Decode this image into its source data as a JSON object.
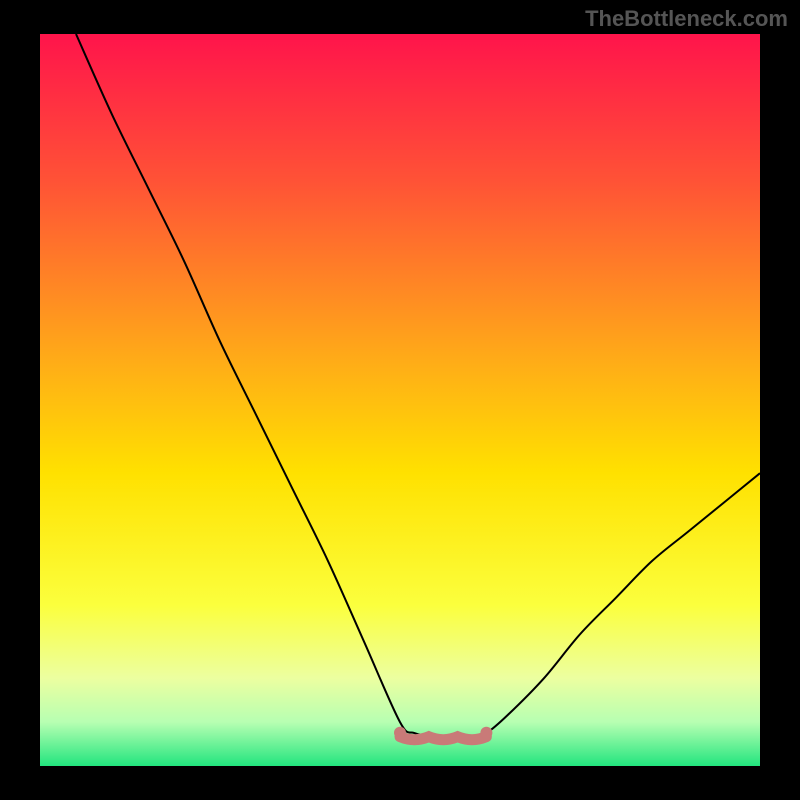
{
  "watermark": "TheBottleneck.com",
  "chart_data": {
    "type": "line",
    "title": "",
    "xlabel": "",
    "ylabel": "",
    "xlim": [
      0,
      1
    ],
    "ylim": [
      0,
      1
    ],
    "background_gradient": {
      "type": "vertical",
      "stops": [
        {
          "pos": 0.0,
          "color": "#ff144b"
        },
        {
          "pos": 0.2,
          "color": "#ff5236"
        },
        {
          "pos": 0.45,
          "color": "#ffad17"
        },
        {
          "pos": 0.6,
          "color": "#ffe100"
        },
        {
          "pos": 0.78,
          "color": "#fbff3d"
        },
        {
          "pos": 0.88,
          "color": "#ecffa0"
        },
        {
          "pos": 0.94,
          "color": "#b7ffb2"
        },
        {
          "pos": 1.0,
          "color": "#22e57e"
        }
      ]
    },
    "curve": {
      "note": "V-shaped curve; y=1 at top, y=0 at bottom. Flat valley ~x 0.50–0.62 at y≈0.04, left arm rises to top-left corner, right arm rises to ~y 0.40 at x=1.",
      "x": [
        0.05,
        0.1,
        0.15,
        0.2,
        0.25,
        0.3,
        0.35,
        0.4,
        0.45,
        0.5,
        0.52,
        0.55,
        0.58,
        0.6,
        0.62,
        0.65,
        0.7,
        0.75,
        0.8,
        0.85,
        0.9,
        0.95,
        1.0
      ],
      "y": [
        1.0,
        0.89,
        0.79,
        0.69,
        0.58,
        0.48,
        0.38,
        0.28,
        0.17,
        0.06,
        0.045,
        0.04,
        0.04,
        0.04,
        0.045,
        0.07,
        0.12,
        0.18,
        0.23,
        0.28,
        0.32,
        0.36,
        0.4
      ]
    },
    "valley_marker": {
      "note": "thick pale-red underline under the curve minimum",
      "x_range": [
        0.5,
        0.62
      ],
      "y": 0.04,
      "color": "#c97a78"
    }
  }
}
